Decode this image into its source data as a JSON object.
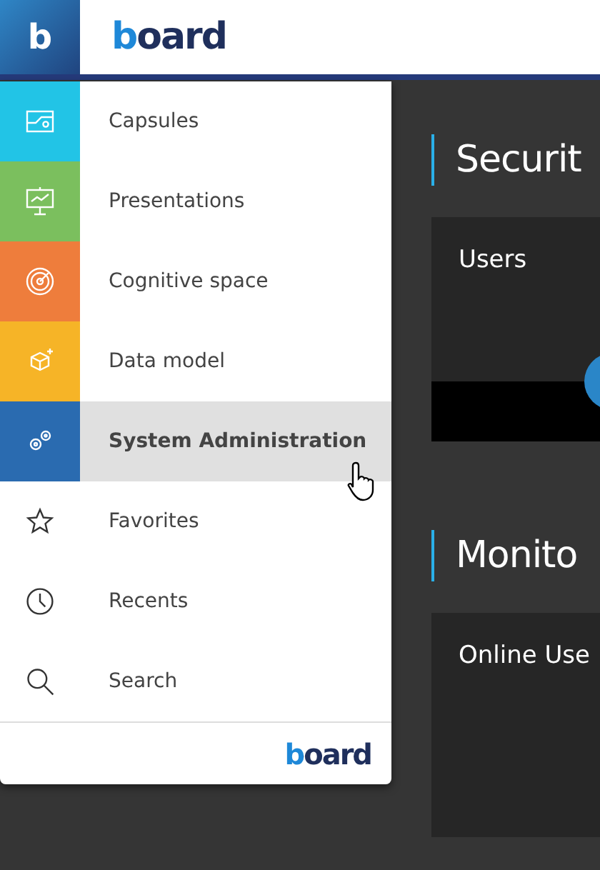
{
  "header": {
    "app_mark": "b",
    "logo": "board"
  },
  "menu": {
    "items": [
      {
        "label": "Capsules",
        "kind": "tile",
        "color": "#22c4e6",
        "selected": false
      },
      {
        "label": "Presentations",
        "kind": "tile",
        "color": "#7bbf5e",
        "selected": false
      },
      {
        "label": "Cognitive space",
        "kind": "tile",
        "color": "#ee7d3c",
        "selected": false
      },
      {
        "label": "Data model",
        "kind": "tile",
        "color": "#f6b427",
        "selected": false
      },
      {
        "label": "System Administration",
        "kind": "tile",
        "color": "#2a6bb0",
        "selected": true
      },
      {
        "label": "Favorites",
        "kind": "plain",
        "selected": false
      },
      {
        "label": "Recents",
        "kind": "plain",
        "selected": false
      },
      {
        "label": "Search",
        "kind": "plain",
        "selected": false
      }
    ],
    "footer_logo": "board"
  },
  "sections": [
    {
      "title": "Securit",
      "card": {
        "title": "Users"
      }
    },
    {
      "title": "Monito",
      "card": {
        "title": "Online Use"
      }
    }
  ]
}
